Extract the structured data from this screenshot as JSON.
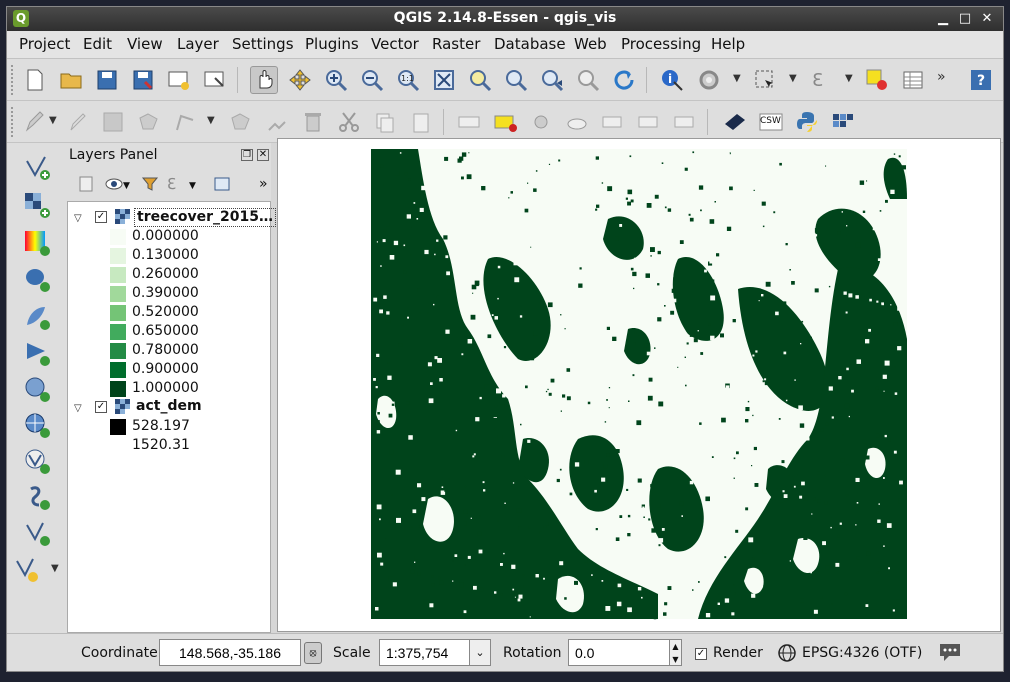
{
  "window": {
    "title": "QGIS 2.14.8-Essen - qgis_vis",
    "logo_letter": "Q",
    "minimize": "▁",
    "maximize": "□",
    "close": "✕"
  },
  "menu": [
    "Project",
    "Edit",
    "View",
    "Layer",
    "Settings",
    "Plugins",
    "Vector",
    "Raster",
    "Database",
    "Web",
    "Processing",
    "Help"
  ],
  "toolbar2": {
    "csw_label": "CSW"
  },
  "layers_panel": {
    "title": "Layers Panel",
    "layers": [
      {
        "name": "treecover_2015…",
        "checked": true,
        "legend": [
          {
            "label": "0.000000",
            "color": "#f7fcf5"
          },
          {
            "label": "0.130000",
            "color": "#e5f5e0"
          },
          {
            "label": "0.260000",
            "color": "#c7e9c0"
          },
          {
            "label": "0.390000",
            "color": "#a1d99b"
          },
          {
            "label": "0.520000",
            "color": "#74c476"
          },
          {
            "label": "0.650000",
            "color": "#41ab5d"
          },
          {
            "label": "0.780000",
            "color": "#238b45"
          },
          {
            "label": "0.900000",
            "color": "#006d2c"
          },
          {
            "label": "1.000000",
            "color": "#00441b"
          }
        ]
      },
      {
        "name": "act_dem",
        "checked": true,
        "legend": [
          {
            "label": "528.197",
            "color": "#000000"
          },
          {
            "label": "1520.31",
            "color": "#ffffff"
          }
        ]
      }
    ]
  },
  "map": {
    "forest_color": "#00441b",
    "open_color": "#f7fcf5"
  },
  "status": {
    "coordinate_label": "Coordinate",
    "coordinate_value": "148.568,-35.186",
    "scale_label": "Scale",
    "scale_value": "1:375,754",
    "rotation_label": "Rotation",
    "rotation_value": "0.0",
    "render_label": "Render",
    "render_checked": true,
    "crs_label": "EPSG:4326 (OTF)"
  }
}
